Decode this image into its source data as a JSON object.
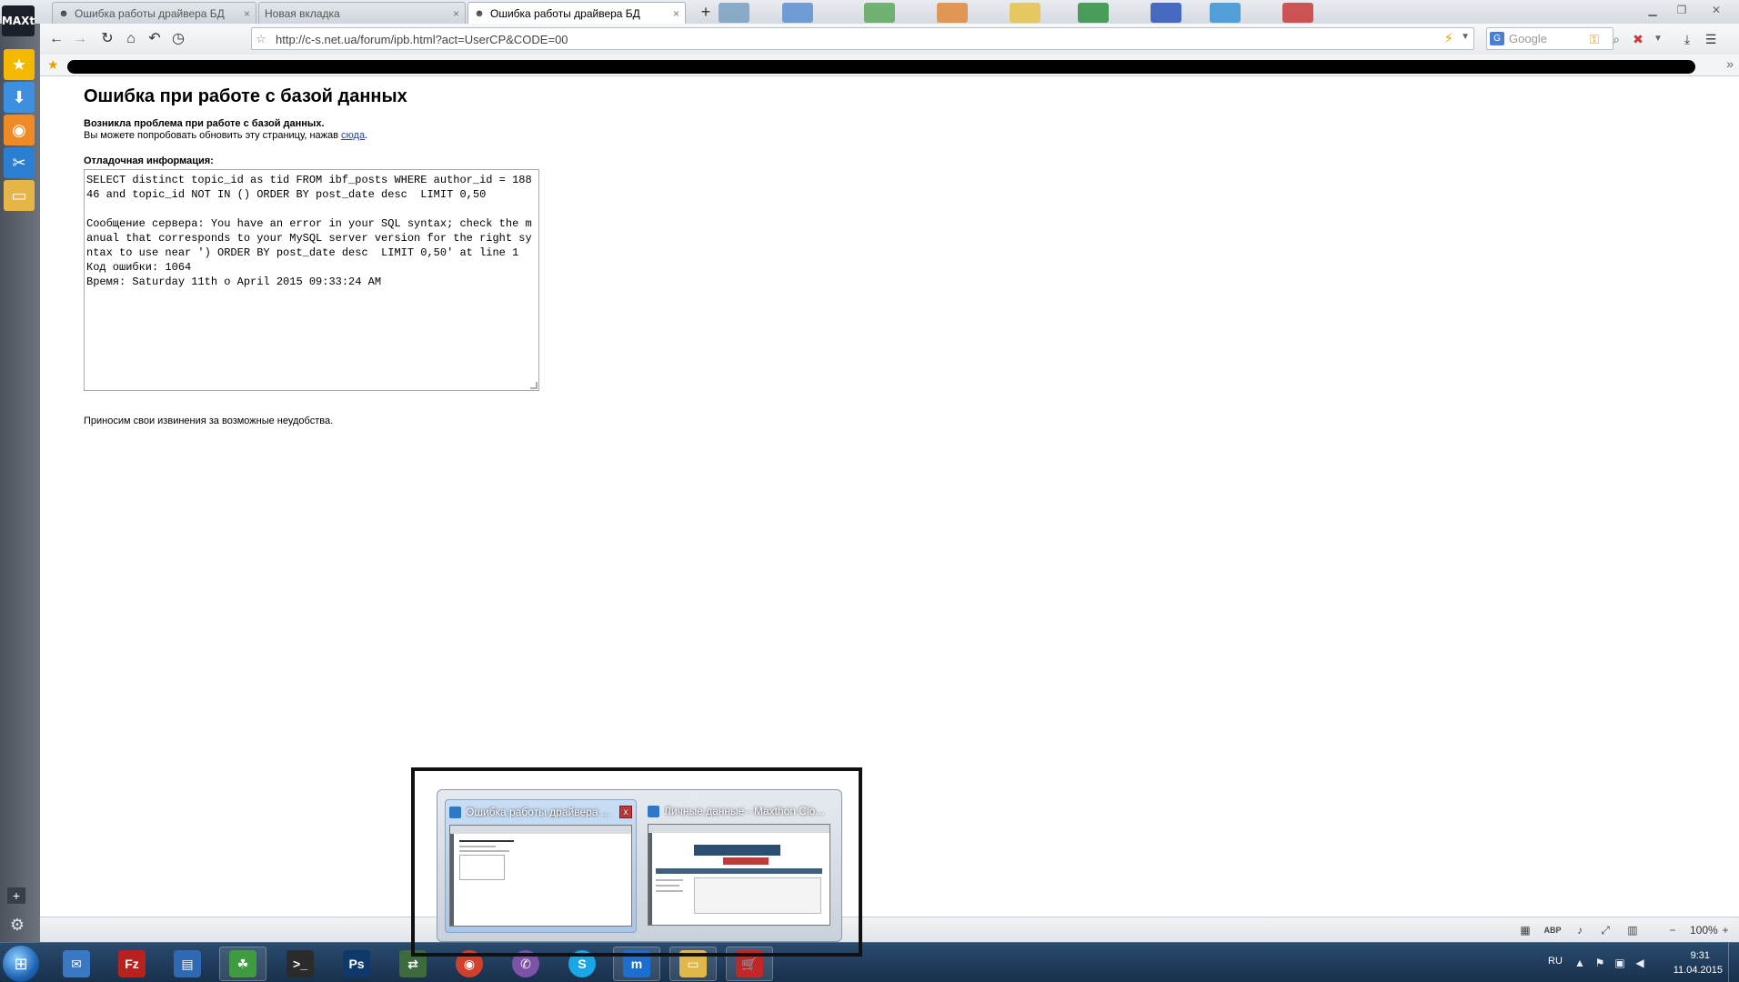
{
  "browser": {
    "app_logo": "MAXt",
    "tabs": [
      {
        "title": "Ошибка работы драйвера БД",
        "active": false
      },
      {
        "title": "Новая вкладка",
        "active": false
      },
      {
        "title": "Ошибка работы драйвера БД",
        "active": true
      }
    ],
    "new_tab_symbol": "+",
    "address": "http://c-s.net.ua/forum/ipb.html?act=UserCP&CODE=00",
    "search_placeholder": "Google",
    "search_engine_badge": "G",
    "zoom": "100%"
  },
  "page": {
    "title": "Ошибка при работе с базой данных",
    "problem_heading": "Возникла проблема при работе с базой данных.",
    "retry_text": "Вы можете попробовать обновить эту страницу, нажав ",
    "retry_link": "сюда",
    "retry_end": ".",
    "debug_label": "Отладочная информация:",
    "debug_text": "SELECT distinct topic_id as tid FROM ibf_posts WHERE author_id = 18846 and topic_id NOT IN () ORDER BY post_date desc  LIMIT 0,50\n\nСообщение сервера: You have an error in your SQL syntax; check the manual that corresponds to your MySQL server version for the right syntax to use near ') ORDER BY post_date desc  LIMIT 0,50' at line 1\nКод ошибки: 1064\nВремя: Saturday 11th o April 2015 09:33:24 AM",
    "apology": "Приносим свои извинения за возможные неудобства."
  },
  "taskbar": {
    "language": "RU",
    "time": "9:31",
    "date": "11.04.2015",
    "apps": [
      {
        "name": "thunderbird",
        "glyph": "✉",
        "color": "#3a78c4"
      },
      {
        "name": "filezilla",
        "glyph": "Fz",
        "color": "#b8221d"
      },
      {
        "name": "calculator",
        "glyph": "▤",
        "color": "#2f68b3"
      },
      {
        "name": "network",
        "glyph": "☘",
        "color": "#3f9b3f"
      },
      {
        "name": "terminal",
        "glyph": ">_",
        "color": "#2b2b2b"
      },
      {
        "name": "photoshop",
        "glyph": "Ps",
        "color": "#0d3a6b"
      },
      {
        "name": "remote",
        "glyph": "⇄",
        "color": "#3d6b3d"
      },
      {
        "name": "chrome",
        "glyph": "◉",
        "color": "#d0412c"
      },
      {
        "name": "viber",
        "glyph": "✆",
        "color": "#7b54a8"
      },
      {
        "name": "skype",
        "glyph": "S",
        "color": "#1ba6e8"
      },
      {
        "name": "maxthon",
        "glyph": "m",
        "color": "#1d6fcf"
      },
      {
        "name": "explorer",
        "glyph": "▭",
        "color": "#e0b84a"
      },
      {
        "name": "store",
        "glyph": "🛒",
        "color": "#c22727"
      }
    ],
    "previews": [
      {
        "title": "Ошибка работы драйвера ...",
        "active": true,
        "close_symbol": "x"
      },
      {
        "title": "Личные данные - Maxthon Clo...",
        "active": false
      }
    ]
  },
  "colors": {
    "link": "#1a3bd6",
    "taskbar": "#1e3a58",
    "sidebar": "#5b626c"
  }
}
